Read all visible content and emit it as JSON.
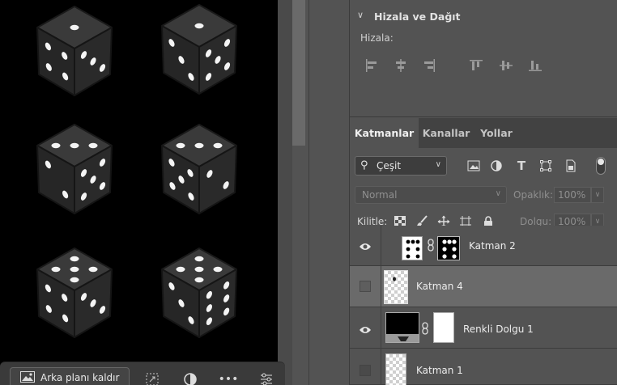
{
  "taskbar": {
    "remove_background_label": "Arka planı kaldır",
    "icons": [
      "image-icon",
      "transform-icon",
      "adjustment-icon",
      "more-icon",
      "sliders-icon"
    ]
  },
  "align_panel": {
    "title": "Hizala ve Dağıt",
    "align_label": "Hizala:",
    "buttons": [
      "align-left",
      "align-horizontal-center",
      "align-right",
      "align-top",
      "align-vertical-center",
      "align-bottom"
    ]
  },
  "layers_panel": {
    "tabs": [
      {
        "label": "Katmanlar",
        "active": true
      },
      {
        "label": "Kanallar",
        "active": false
      },
      {
        "label": "Yollar",
        "active": false
      }
    ],
    "filter": {
      "value": "Çeşit"
    },
    "blend_mode": "Normal",
    "opacity_label": "Opaklık:",
    "opacity_value": "100%",
    "lock_label": "Kilitle:",
    "fill_label": "Dolgu:",
    "fill_value": "100%",
    "layers": [
      {
        "name": "Katman 2",
        "visible": true,
        "selected": false,
        "has_mask": true
      },
      {
        "name": "Katman 4",
        "visible": false,
        "selected": true,
        "has_mask": false
      },
      {
        "name": "Renkli Dolgu 1",
        "visible": true,
        "selected": false,
        "has_mask": true
      },
      {
        "name": "Katman 1",
        "visible": false,
        "selected": false,
        "has_mask": false
      }
    ]
  },
  "colors": {
    "canvas": "#000000",
    "panel": "#535353",
    "selected_layer": "#6a6a6a",
    "die_body": "#2a2a2a"
  }
}
